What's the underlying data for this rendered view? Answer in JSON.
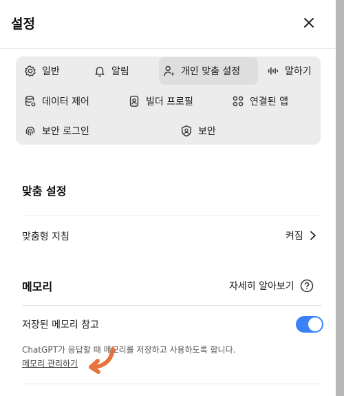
{
  "header": {
    "title": "설정"
  },
  "tabs": [
    {
      "label": "일반",
      "icon": "gear-icon"
    },
    {
      "label": "알림",
      "icon": "bell-icon"
    },
    {
      "label": "개인 맞춤 설정",
      "icon": "person-sparkle-icon",
      "active": true
    },
    {
      "label": "말하기",
      "icon": "waveform-icon"
    },
    {
      "label": "데이터 제어",
      "icon": "database-gear-icon"
    },
    {
      "label": "빌더 프로필",
      "icon": "id-badge-icon"
    },
    {
      "label": "연결된 앱",
      "icon": "apps-grid-icon"
    },
    {
      "label": "보안 로그인",
      "icon": "fingerprint-icon"
    },
    {
      "label": "보안",
      "icon": "shield-user-icon"
    }
  ],
  "personalization": {
    "section_title": "맞춤 설정",
    "custom_instructions_label": "맞춤형 지침",
    "custom_instructions_value": "켜짐"
  },
  "memory": {
    "section_title": "메모리",
    "learn_more": "자세히 알아보기",
    "saved_memory_label": "저장된 메모리 참고",
    "saved_memory_on": true,
    "description": "ChatGPT가 응답할 때 메모리를 저장하고 사용하도록 합니다.",
    "manage_link": "메모리 관리하기"
  },
  "colors": {
    "accent": "#3b82f6",
    "annotation_arrow": "#e8713c"
  }
}
